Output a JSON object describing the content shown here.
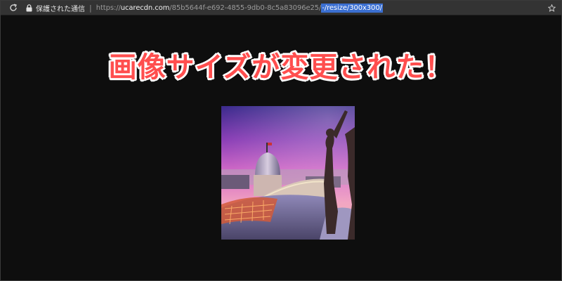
{
  "browser": {
    "security_label": "保護された通信",
    "separator": "|",
    "url": {
      "scheme": "https://",
      "host": "ucarecdn.com",
      "path": "/85b5644f-e692-4855-9db0-8c5a83096e25/",
      "selected": "-/resize/300x300/"
    },
    "icons": {
      "reload": "reload-icon",
      "lock": "lock-icon",
      "bookmark": "star-icon"
    }
  },
  "page": {
    "headline": "画像サイズが変更された！",
    "headline_color": "#ff4e4e",
    "image": {
      "name": "resized-photo",
      "size": "300x300"
    }
  }
}
